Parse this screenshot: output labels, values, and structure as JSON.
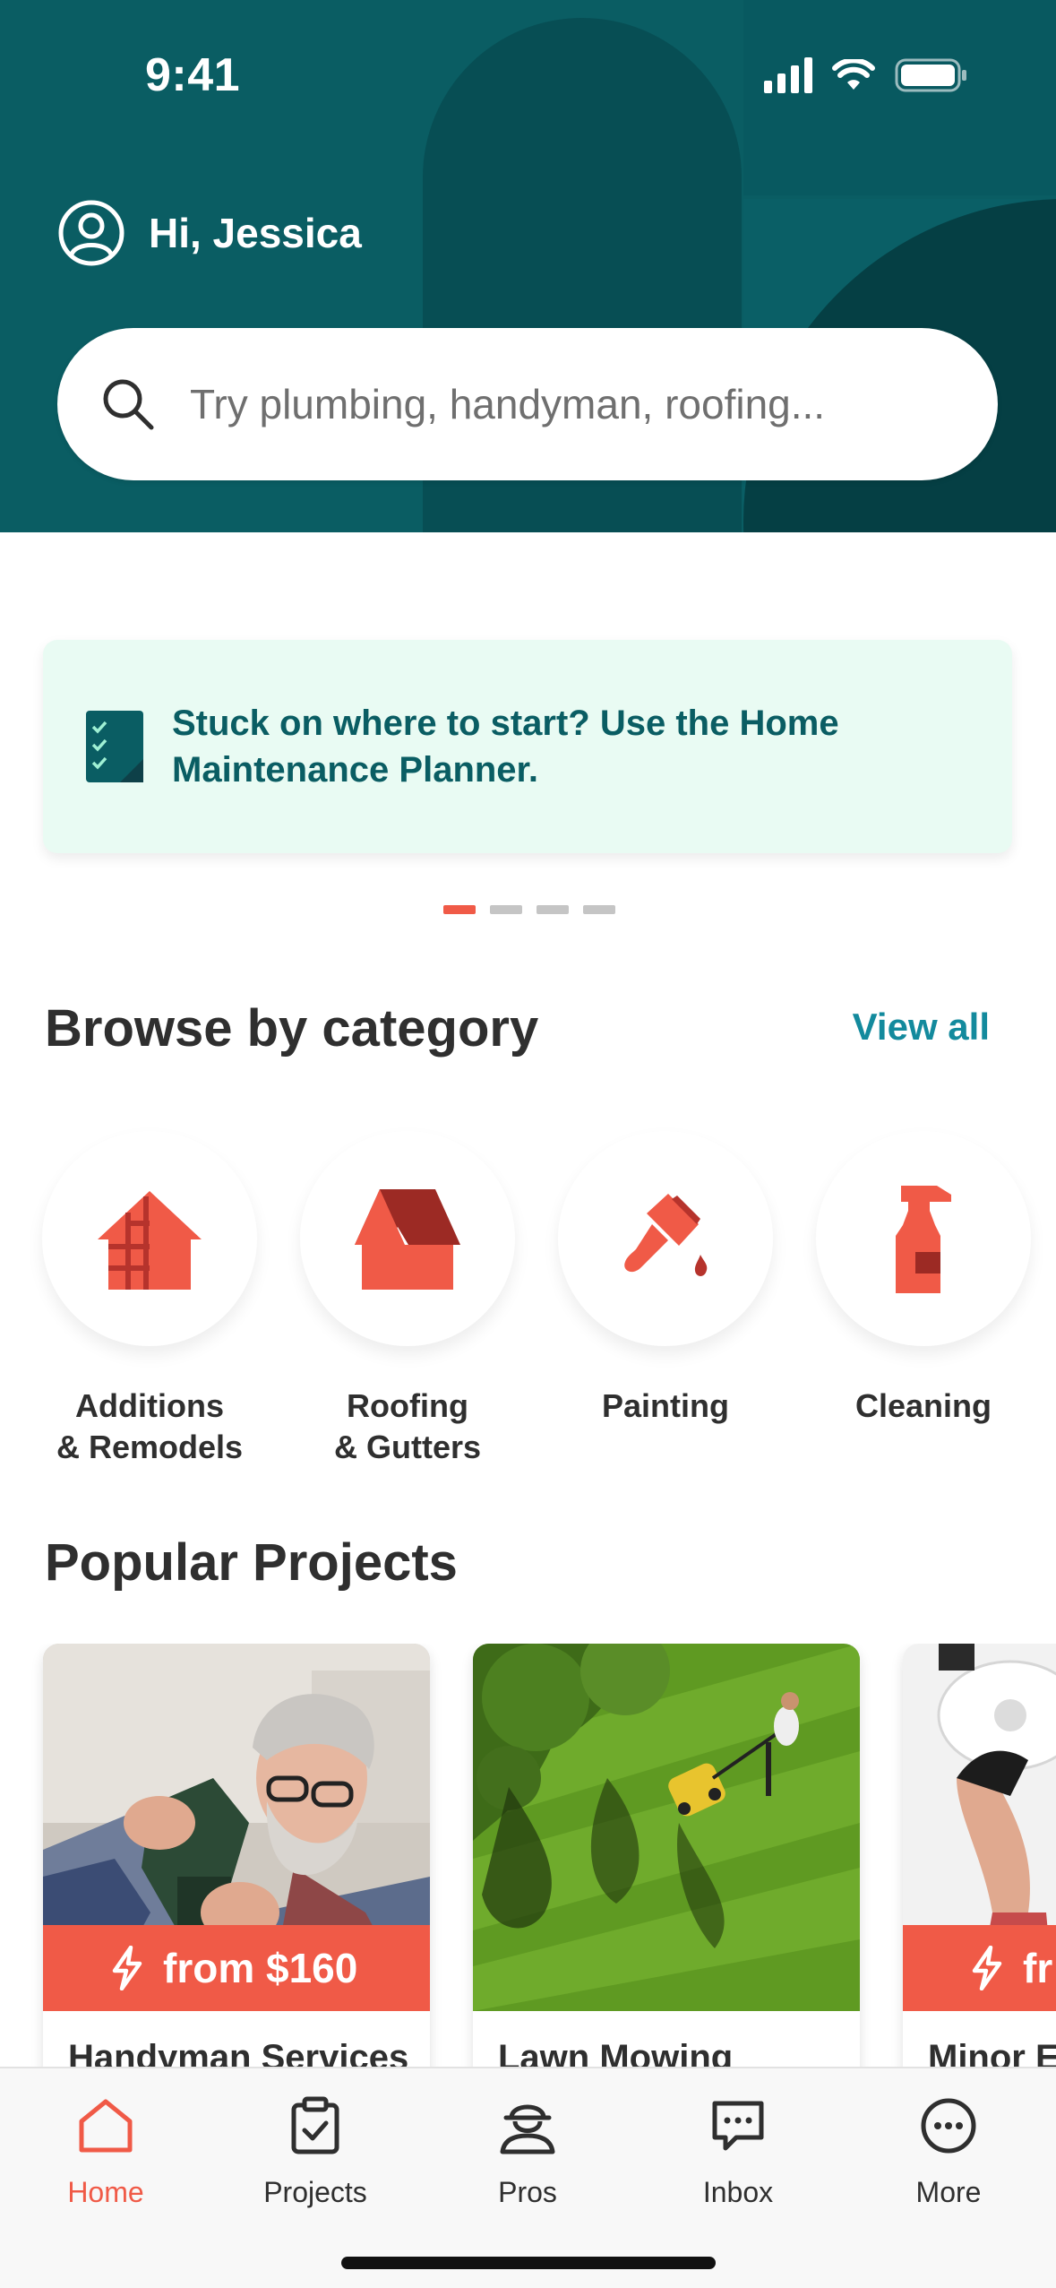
{
  "status_bar": {
    "time": "9:41"
  },
  "header": {
    "greeting": "Hi, Jessica",
    "search_placeholder": "Try plumbing, handyman, roofing..."
  },
  "banner": {
    "text": "Stuck on where to start? Use the Home Maintenance Planner.",
    "page_count": 4,
    "active_page": 1
  },
  "browse": {
    "title": "Browse by category",
    "view_all": "View all",
    "categories": [
      {
        "label": "Additions\n& Remodels",
        "icon": "house-additions-icon"
      },
      {
        "label": "Roofing\n& Gutters",
        "icon": "house-roof-icon"
      },
      {
        "label": "Painting",
        "icon": "paintbrush-icon"
      },
      {
        "label": "Cleaning",
        "icon": "spray-bottle-icon"
      }
    ]
  },
  "popular": {
    "title": "Popular Projects",
    "projects": [
      {
        "title": "Handyman Services",
        "price": "from $160"
      },
      {
        "title": "Lawn Mowing",
        "price": ""
      },
      {
        "title": "Minor E",
        "price": "fr"
      }
    ]
  },
  "tabbar": {
    "tabs": [
      {
        "label": "Home",
        "icon": "home-icon",
        "active": true
      },
      {
        "label": "Projects",
        "icon": "clipboard-check-icon",
        "active": false
      },
      {
        "label": "Pros",
        "icon": "pro-person-icon",
        "active": false
      },
      {
        "label": "Inbox",
        "icon": "chat-bubble-icon",
        "active": false
      },
      {
        "label": "More",
        "icon": "more-dots-icon",
        "active": false
      }
    ]
  },
  "colors": {
    "header_bg": "#0a5d63",
    "accent": "#f05a47",
    "link": "#138a9d",
    "banner_bg": "#e9fbf3"
  }
}
